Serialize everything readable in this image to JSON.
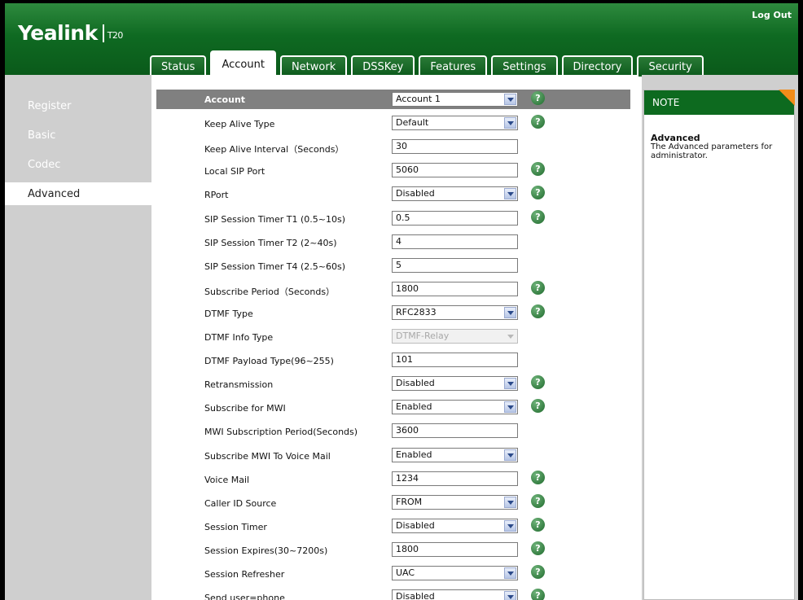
{
  "header": {
    "brand": "Yealink",
    "model": "T20",
    "logout_label": "Log Out",
    "colors": {
      "header_green": "#0f6a22",
      "note_green": "#0d6a1f",
      "accent_orange": "#f28c1a"
    }
  },
  "tabs": [
    {
      "label": "Status"
    },
    {
      "label": "Account",
      "active": true
    },
    {
      "label": "Network"
    },
    {
      "label": "DSSKey"
    },
    {
      "label": "Features"
    },
    {
      "label": "Settings"
    },
    {
      "label": "Directory"
    },
    {
      "label": "Security"
    }
  ],
  "sidebar": {
    "items": [
      {
        "label": "Register"
      },
      {
        "label": "Basic"
      },
      {
        "label": "Codec"
      },
      {
        "label": "Advanced",
        "active": true
      }
    ]
  },
  "form": {
    "rows": [
      {
        "label": "Account",
        "type": "select",
        "value": "Account 1",
        "help": true
      },
      {
        "label": "Keep Alive Type",
        "type": "select",
        "value": "Default",
        "help": true
      },
      {
        "label": "Keep Alive Interval（Seconds）",
        "type": "input",
        "value": "30",
        "help": false
      },
      {
        "label": "Local SIP Port",
        "type": "input",
        "value": "5060",
        "help": true
      },
      {
        "label": "RPort",
        "type": "select",
        "value": "Disabled",
        "help": true
      },
      {
        "label": "SIP Session Timer T1 (0.5~10s)",
        "type": "input",
        "value": "0.5",
        "help": true
      },
      {
        "label": "SIP Session Timer T2 (2~40s)",
        "type": "input",
        "value": "4",
        "help": false
      },
      {
        "label": "SIP Session Timer T4 (2.5~60s)",
        "type": "input",
        "value": "5",
        "help": false
      },
      {
        "label": "Subscribe Period（Seconds）",
        "type": "input",
        "value": "1800",
        "help": true
      },
      {
        "label": "DTMF Type",
        "type": "select",
        "value": "RFC2833",
        "help": true
      },
      {
        "label": "DTMF Info Type",
        "type": "select",
        "value": "DTMF-Relay",
        "help": false,
        "disabled": true
      },
      {
        "label": "DTMF Payload Type(96~255)",
        "type": "input",
        "value": "101",
        "help": false
      },
      {
        "label": "Retransmission",
        "type": "select",
        "value": "Disabled",
        "help": true
      },
      {
        "label": "Subscribe for MWI",
        "type": "select",
        "value": "Enabled",
        "help": true
      },
      {
        "label": "MWI Subscription Period(Seconds)",
        "type": "input",
        "value": "3600",
        "help": false
      },
      {
        "label": "Subscribe MWI To Voice Mail",
        "type": "select",
        "value": "Enabled",
        "help": false
      },
      {
        "label": "Voice Mail",
        "type": "input",
        "value": "1234",
        "help": true
      },
      {
        "label": "Caller ID Source",
        "type": "select",
        "value": "FROM",
        "help": true
      },
      {
        "label": "Session Timer",
        "type": "select",
        "value": "Disabled",
        "help": true
      },
      {
        "label": "Session Expires(30~7200s)",
        "type": "input",
        "value": "1800",
        "help": true
      },
      {
        "label": "Session Refresher",
        "type": "select",
        "value": "UAC",
        "help": true
      },
      {
        "label": "Send user=phone",
        "type": "select",
        "value": "Disabled",
        "help": true
      }
    ],
    "help_glyph": "?"
  },
  "note": {
    "header": "NOTE",
    "title": "Advanced",
    "text": "The Advanced parameters for administrator."
  }
}
